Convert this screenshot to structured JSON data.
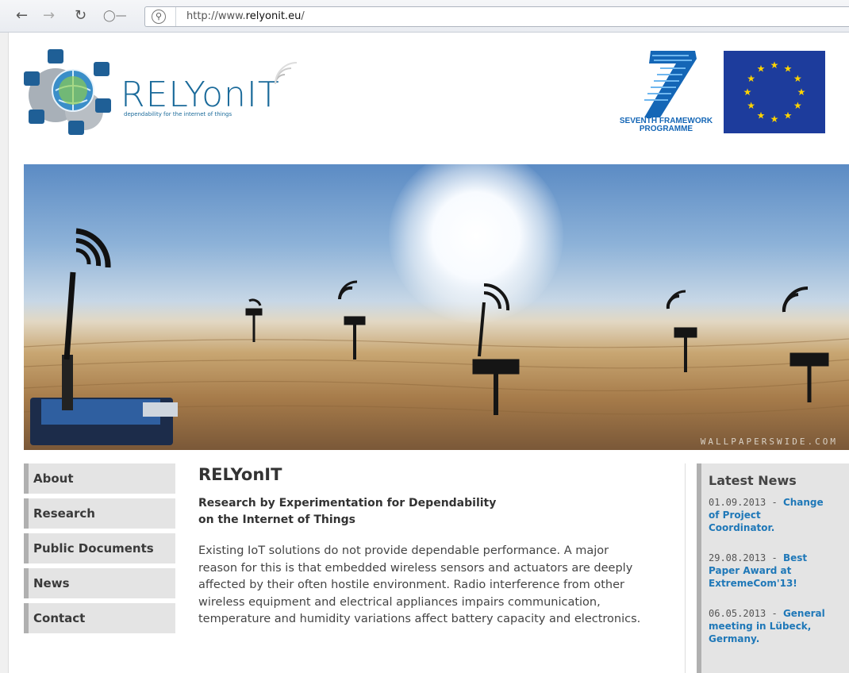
{
  "browser": {
    "url_prefix": "http://www.",
    "url_domain": "relyonit.eu",
    "url_suffix": "/",
    "icons": [
      "back-icon",
      "forward-icon",
      "reload-icon",
      "key-icon",
      "globe-icon"
    ]
  },
  "header": {
    "brand": "RELYonIT",
    "tagline": "dependability for the internet of things",
    "fp7_line1": "SEVENTH FRAMEWORK",
    "fp7_line2": "PROGRAMME"
  },
  "hero": {
    "watermark": "WALLPAPERSWIDE.COM"
  },
  "nav": {
    "items": [
      "About",
      "Research",
      "Public Documents",
      "News",
      "Contact"
    ]
  },
  "main": {
    "title": "RELYonIT",
    "subtitle_line1": "Research by Experimentation for Dependability",
    "subtitle_line2": "on the Internet of Things",
    "paragraph": "Existing IoT solutions do not provide dependable performance. A major reason for this is that embedded wireless sensors and actuators are deeply affected by their often hostile environment. Radio interference from other wireless equipment and electrical appliances impairs communication, temperature and humidity variations affect battery capacity and electronics."
  },
  "news": {
    "title": "Latest News",
    "items": [
      {
        "date": "01.09.2013",
        "sep": " - ",
        "link": "Change of Project Coordinator."
      },
      {
        "date": "29.08.2013",
        "sep": " - ",
        "link": "Best Paper Award at ExtremeCom'13!"
      },
      {
        "date": "06.05.2013",
        "sep": " - ",
        "link": "General meeting in Lübeck, Germany."
      }
    ]
  },
  "colors": {
    "brand_blue": "#1a6a9a",
    "link_blue": "#1f78b8",
    "eu_blue": "#1d3c9c",
    "star_yellow": "#ffd400"
  }
}
